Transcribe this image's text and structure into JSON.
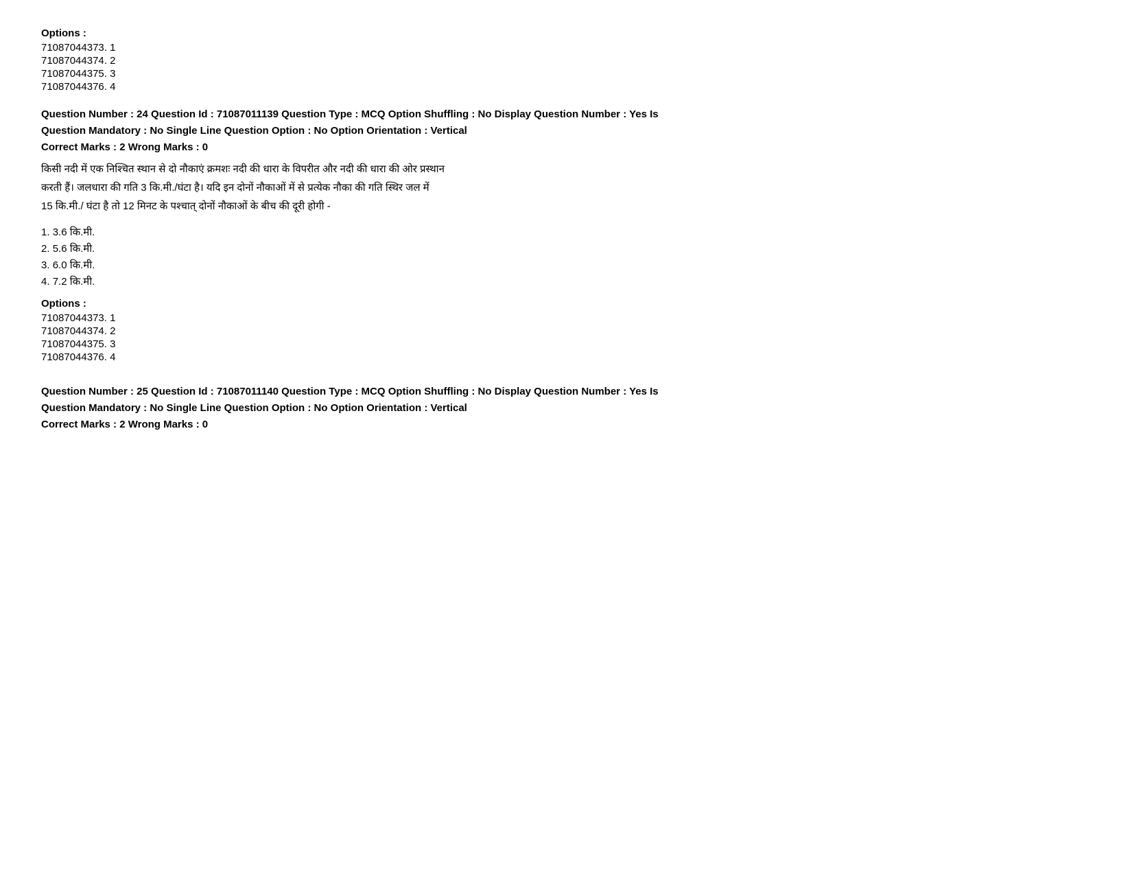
{
  "sections": [
    {
      "id": "section-top-options",
      "options_label": "Options :",
      "options": [
        {
          "id": "71087044373",
          "num": "1"
        },
        {
          "id": "71087044374",
          "num": "2"
        },
        {
          "id": "71087044375",
          "num": "3"
        },
        {
          "id": "71087044376",
          "num": "4"
        }
      ]
    },
    {
      "id": "section-q24",
      "question_header_line1": "Question Number : 24 Question Id : 71087011139 Question Type : MCQ Option Shuffling : No Display Question Number : Yes Is",
      "question_header_line2": "Question Mandatory : No Single Line Question Option : No Option Orientation : Vertical",
      "question_header_line3": "Correct Marks : 2 Wrong Marks : 0",
      "question_body_line1": "किसी नदी में एक निश्चित स्थान से दो नौकाएं क्रमशः नदी की धारा के विपरीत और नदी की धारा की ओर प्रस्थान",
      "question_body_line2": "करती हैं। जलधारा की गति 3 कि.मी./घंटा है। यदि इन दोनों नौकाओं में से प्रत्येक नौका की गति  स्थिर जल में",
      "question_body_line3": "15 कि.मी./ घंटा है तो 12 मिनट के पश्चात् दोनों नौकाओं के बीच की दूरी होगी -",
      "answer_options": [
        {
          "num": "1.",
          "text": "3.6 कि.मी."
        },
        {
          "num": "2.",
          "text": "5.6 कि.मी."
        },
        {
          "num": "3.",
          "text": "6.0 कि.मी."
        },
        {
          "num": "4.",
          "text": "7.2 कि.मी."
        }
      ],
      "options_label": "Options :",
      "options": [
        {
          "id": "71087044373",
          "num": "1"
        },
        {
          "id": "71087044374",
          "num": "2"
        },
        {
          "id": "71087044375",
          "num": "3"
        },
        {
          "id": "71087044376",
          "num": "4"
        }
      ]
    },
    {
      "id": "section-q25",
      "question_header_line1": "Question Number : 25 Question Id : 71087011140 Question Type : MCQ Option Shuffling : No Display Question Number : Yes Is",
      "question_header_line2": "Question Mandatory : No Single Line Question Option : No Option Orientation : Vertical",
      "question_header_line3": "Correct Marks : 2 Wrong Marks : 0"
    }
  ]
}
